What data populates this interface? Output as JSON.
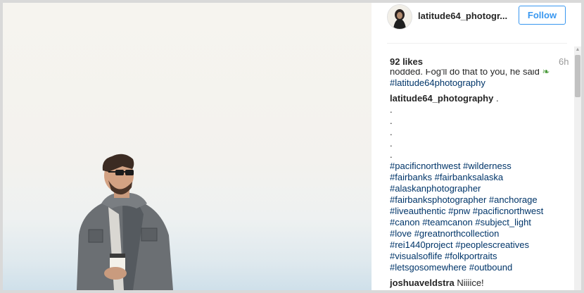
{
  "post": {
    "username": "latitude64_photogr...",
    "follow_label": "Follow",
    "likes": "92 likes",
    "time": "6h"
  },
  "caption": {
    "cut_line": "nodded. Fog'll do that to you, he said",
    "cut_hashtag": "#latitude64photography",
    "author": "latitude64_photography",
    "author_suffix": " .",
    "dots": [
      ".",
      ".",
      ".",
      ".",
      "."
    ],
    "hashtag_lines": [
      "#pacificnorthwest #wilderness",
      "#fairbanks #fairbanksalaska",
      "#alaskanphotographer",
      "#fairbanksphotographer #anchorage",
      "#liveauthentic #pnw #pacificnorthwest",
      "#canon #teamcanon #subject_light",
      "#love #greatnorthcollection",
      "#rei1440project #peoplescreatives",
      "#visualsoflife #folkportraits",
      "#letsgosomewhere #outbound"
    ]
  },
  "comment": {
    "author": "joshuaveldstra",
    "text": "Niiiice!"
  },
  "icons": {
    "leaf": "leaf-emoji-icon",
    "avatar": "profile-avatar"
  }
}
